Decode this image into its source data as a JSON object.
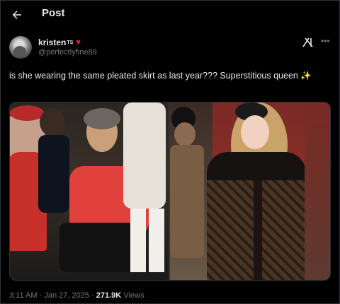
{
  "header": {
    "title": "Post"
  },
  "author": {
    "display_name": "kristen",
    "superscript": "TS",
    "handle": "@perfectlyfine89"
  },
  "tweet": {
    "text": "is she wearing the same pleated skirt as last year??? Superstitious queen",
    "emoji": "✨"
  },
  "meta": {
    "time": "3:11 AM",
    "separator": "·",
    "date": "Jan 27, 2025",
    "separator2": "·",
    "views_count": "271.9K",
    "views_label": "Views"
  },
  "colors": {
    "background": "#000000",
    "text": "#e7e9ea",
    "muted": "#71767b",
    "heart": "#f4212e"
  },
  "icons": {
    "back": "arrow-left-icon",
    "heart": "heart-icon",
    "grok": "grok-icon",
    "more": "more-horizontal-icon"
  }
}
